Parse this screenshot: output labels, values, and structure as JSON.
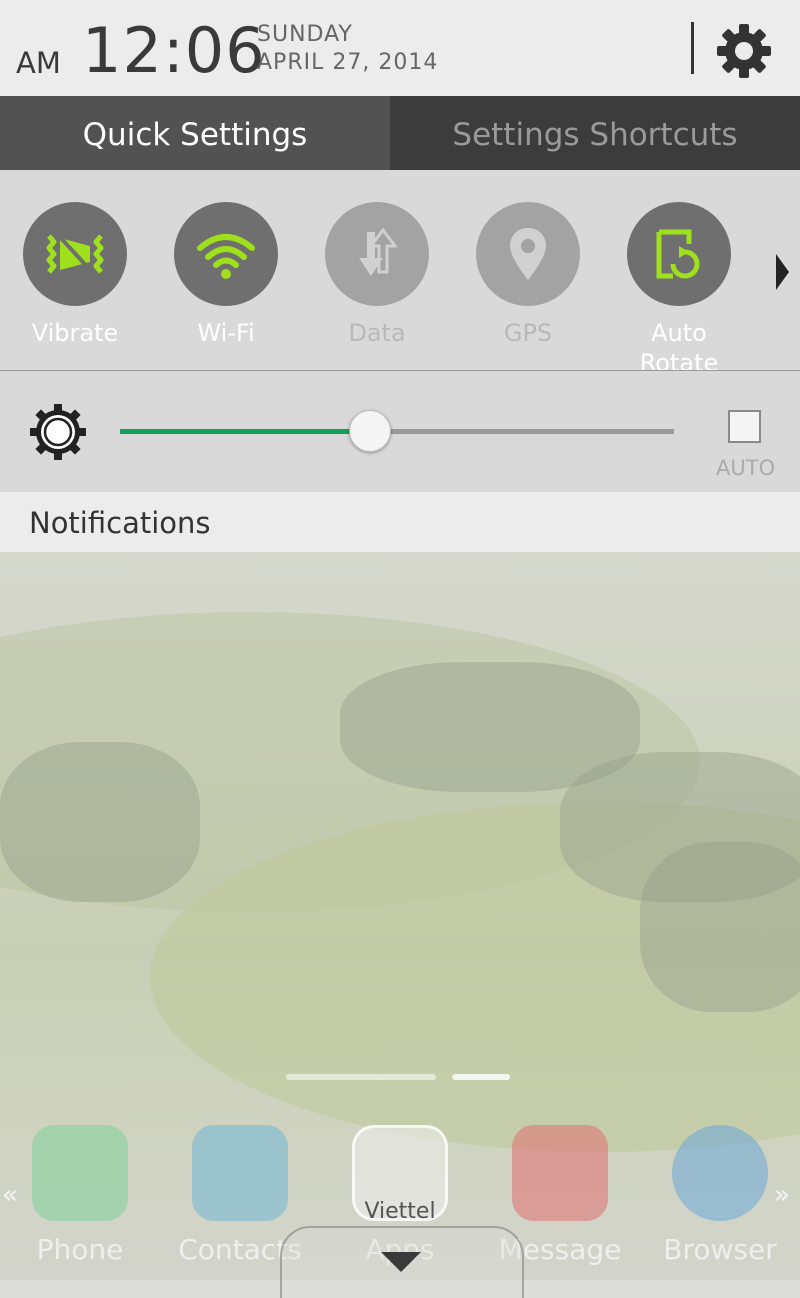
{
  "header": {
    "ampm": "AM",
    "time": "12:06",
    "day": "SUNDAY",
    "date": "APRIL 27, 2014",
    "settings_icon": "gear-icon"
  },
  "tabs": [
    {
      "label": "Quick Settings",
      "active": true
    },
    {
      "label": "Settings Shortcuts",
      "active": false
    }
  ],
  "quick_settings": {
    "accent_color": "#9ee01c",
    "toggles": [
      {
        "label": "Vibrate",
        "icon": "vibrate-icon",
        "state": "on"
      },
      {
        "label": "Wi-Fi",
        "icon": "wifi-icon",
        "state": "on"
      },
      {
        "label": "Data",
        "icon": "data-icon",
        "state": "off"
      },
      {
        "label": "GPS",
        "icon": "gps-icon",
        "state": "off"
      },
      {
        "label": "Auto Rotate",
        "icon": "auto-rotate-icon",
        "state": "on"
      }
    ],
    "more_icon": "chevron-right-icon"
  },
  "brightness": {
    "icon": "brightness-icon",
    "level": 0.45,
    "fill_color": "#16a05a",
    "auto_label": "AUTO",
    "auto_checked": false
  },
  "notifications": {
    "label": "Notifications"
  },
  "home": {
    "carrier": "Viettel",
    "left_chevron": "«",
    "right_chevron": "»",
    "dock": [
      {
        "label": "Phone",
        "icon": "phone-icon",
        "color": "#7fd19a"
      },
      {
        "label": "Contacts",
        "icon": "contacts-icon",
        "color": "#6fb6d6"
      },
      {
        "label": "Apps",
        "icon": "apps-icon",
        "color": "#e8e8e8"
      },
      {
        "label": "Message",
        "icon": "message-icon",
        "color": "#e07070"
      },
      {
        "label": "Browser",
        "icon": "globe-icon",
        "color": "#6aa8d8"
      }
    ]
  }
}
